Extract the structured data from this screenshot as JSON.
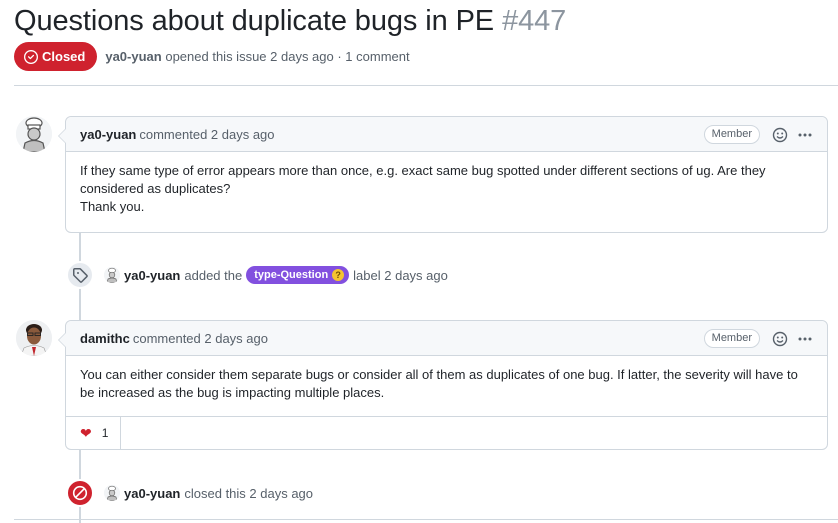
{
  "issue": {
    "title": "Questions about duplicate bugs in PE",
    "number": "#447",
    "state": "Closed",
    "author": "ya0-yuan",
    "meta_text": "opened this issue 2 days ago · 1 comment"
  },
  "comments": [
    {
      "author": "ya0-yuan",
      "action": "commented 2 days ago",
      "role": "Member",
      "body": [
        "If they same type of error appears more than once, e.g. exact same bug spotted under different sections of ug. Are they considered as duplicates?",
        "Thank you."
      ]
    },
    {
      "author": "damithc",
      "action": "commented 2 days ago",
      "role": "Member",
      "body": [
        "You can either consider them separate bugs or consider all of them as duplicates of one bug. If latter, the severity will have to be increased as the bug is impacting multiple places."
      ],
      "reactions": {
        "heart_count": "1"
      }
    }
  ],
  "events": {
    "label_added": {
      "actor": "ya0-yuan",
      "prefix": "added the",
      "label": "type-Question",
      "suffix": "label 2 days ago"
    },
    "closed": {
      "actor": "ya0-yuan",
      "text": "closed this 2 days ago"
    }
  },
  "colors": {
    "closed_red": "#cf222e",
    "label_purple": "#8250df",
    "border": "#d0d7de",
    "muted_text": "#57606a"
  },
  "icons": [
    "issue-closed-icon",
    "smiley-icon",
    "kebab-horizontal-icon",
    "tag-icon",
    "heart-icon",
    "skip-icon"
  ]
}
